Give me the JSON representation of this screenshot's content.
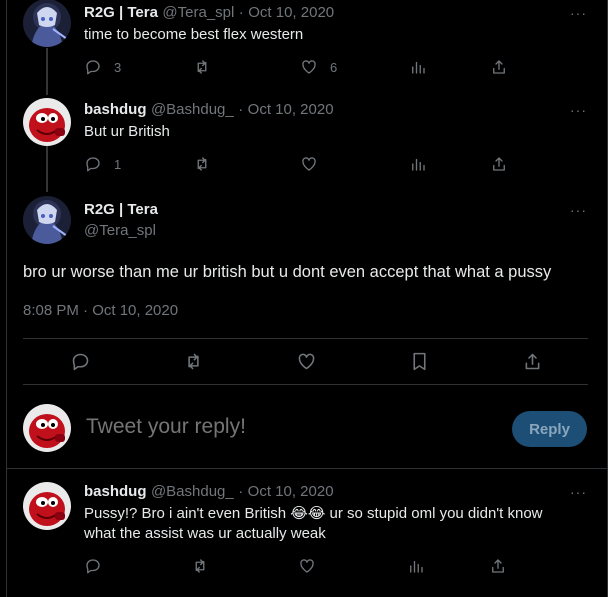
{
  "tweets": [
    {
      "name": "R2G | Tera",
      "handle": "@Tera_spl",
      "sep": "·",
      "date": "Oct 10, 2020",
      "text": "time to become best flex western",
      "replies": "3",
      "likes": "6",
      "avatar": "anime-avatar"
    },
    {
      "name": "bashdug",
      "handle": "@Bashdug_",
      "sep": "·",
      "date": "Oct 10, 2020",
      "text": "But ur British",
      "replies": "1",
      "avatar": "red-knuckles-avatar"
    }
  ],
  "main_tweet": {
    "name": "R2G | Tera",
    "handle": "@Tera_spl",
    "text": "bro ur worse than me ur british but u dont even accept that what a pussy",
    "timestamp": "8:08 PM · Oct 10, 2020"
  },
  "compose": {
    "placeholder": "Tweet your reply!",
    "button": "Reply"
  },
  "reply_tweet": {
    "name": "bashdug",
    "handle": "@Bashdug_",
    "sep": "·",
    "date": "Oct 10, 2020",
    "text_line1_a": "Pussy!? Bro i ain't even British ",
    "text_line1_b": " ur so stupid oml you didn't know",
    "text_line2": "what the assist was ur actually weak",
    "emoji": "😂"
  },
  "more_glyph": "···",
  "colors": {
    "background": "#000000",
    "muted": "#71767b",
    "text": "#e7e9ea",
    "reply_button": "#1d4e75",
    "divider": "#2f3336"
  }
}
